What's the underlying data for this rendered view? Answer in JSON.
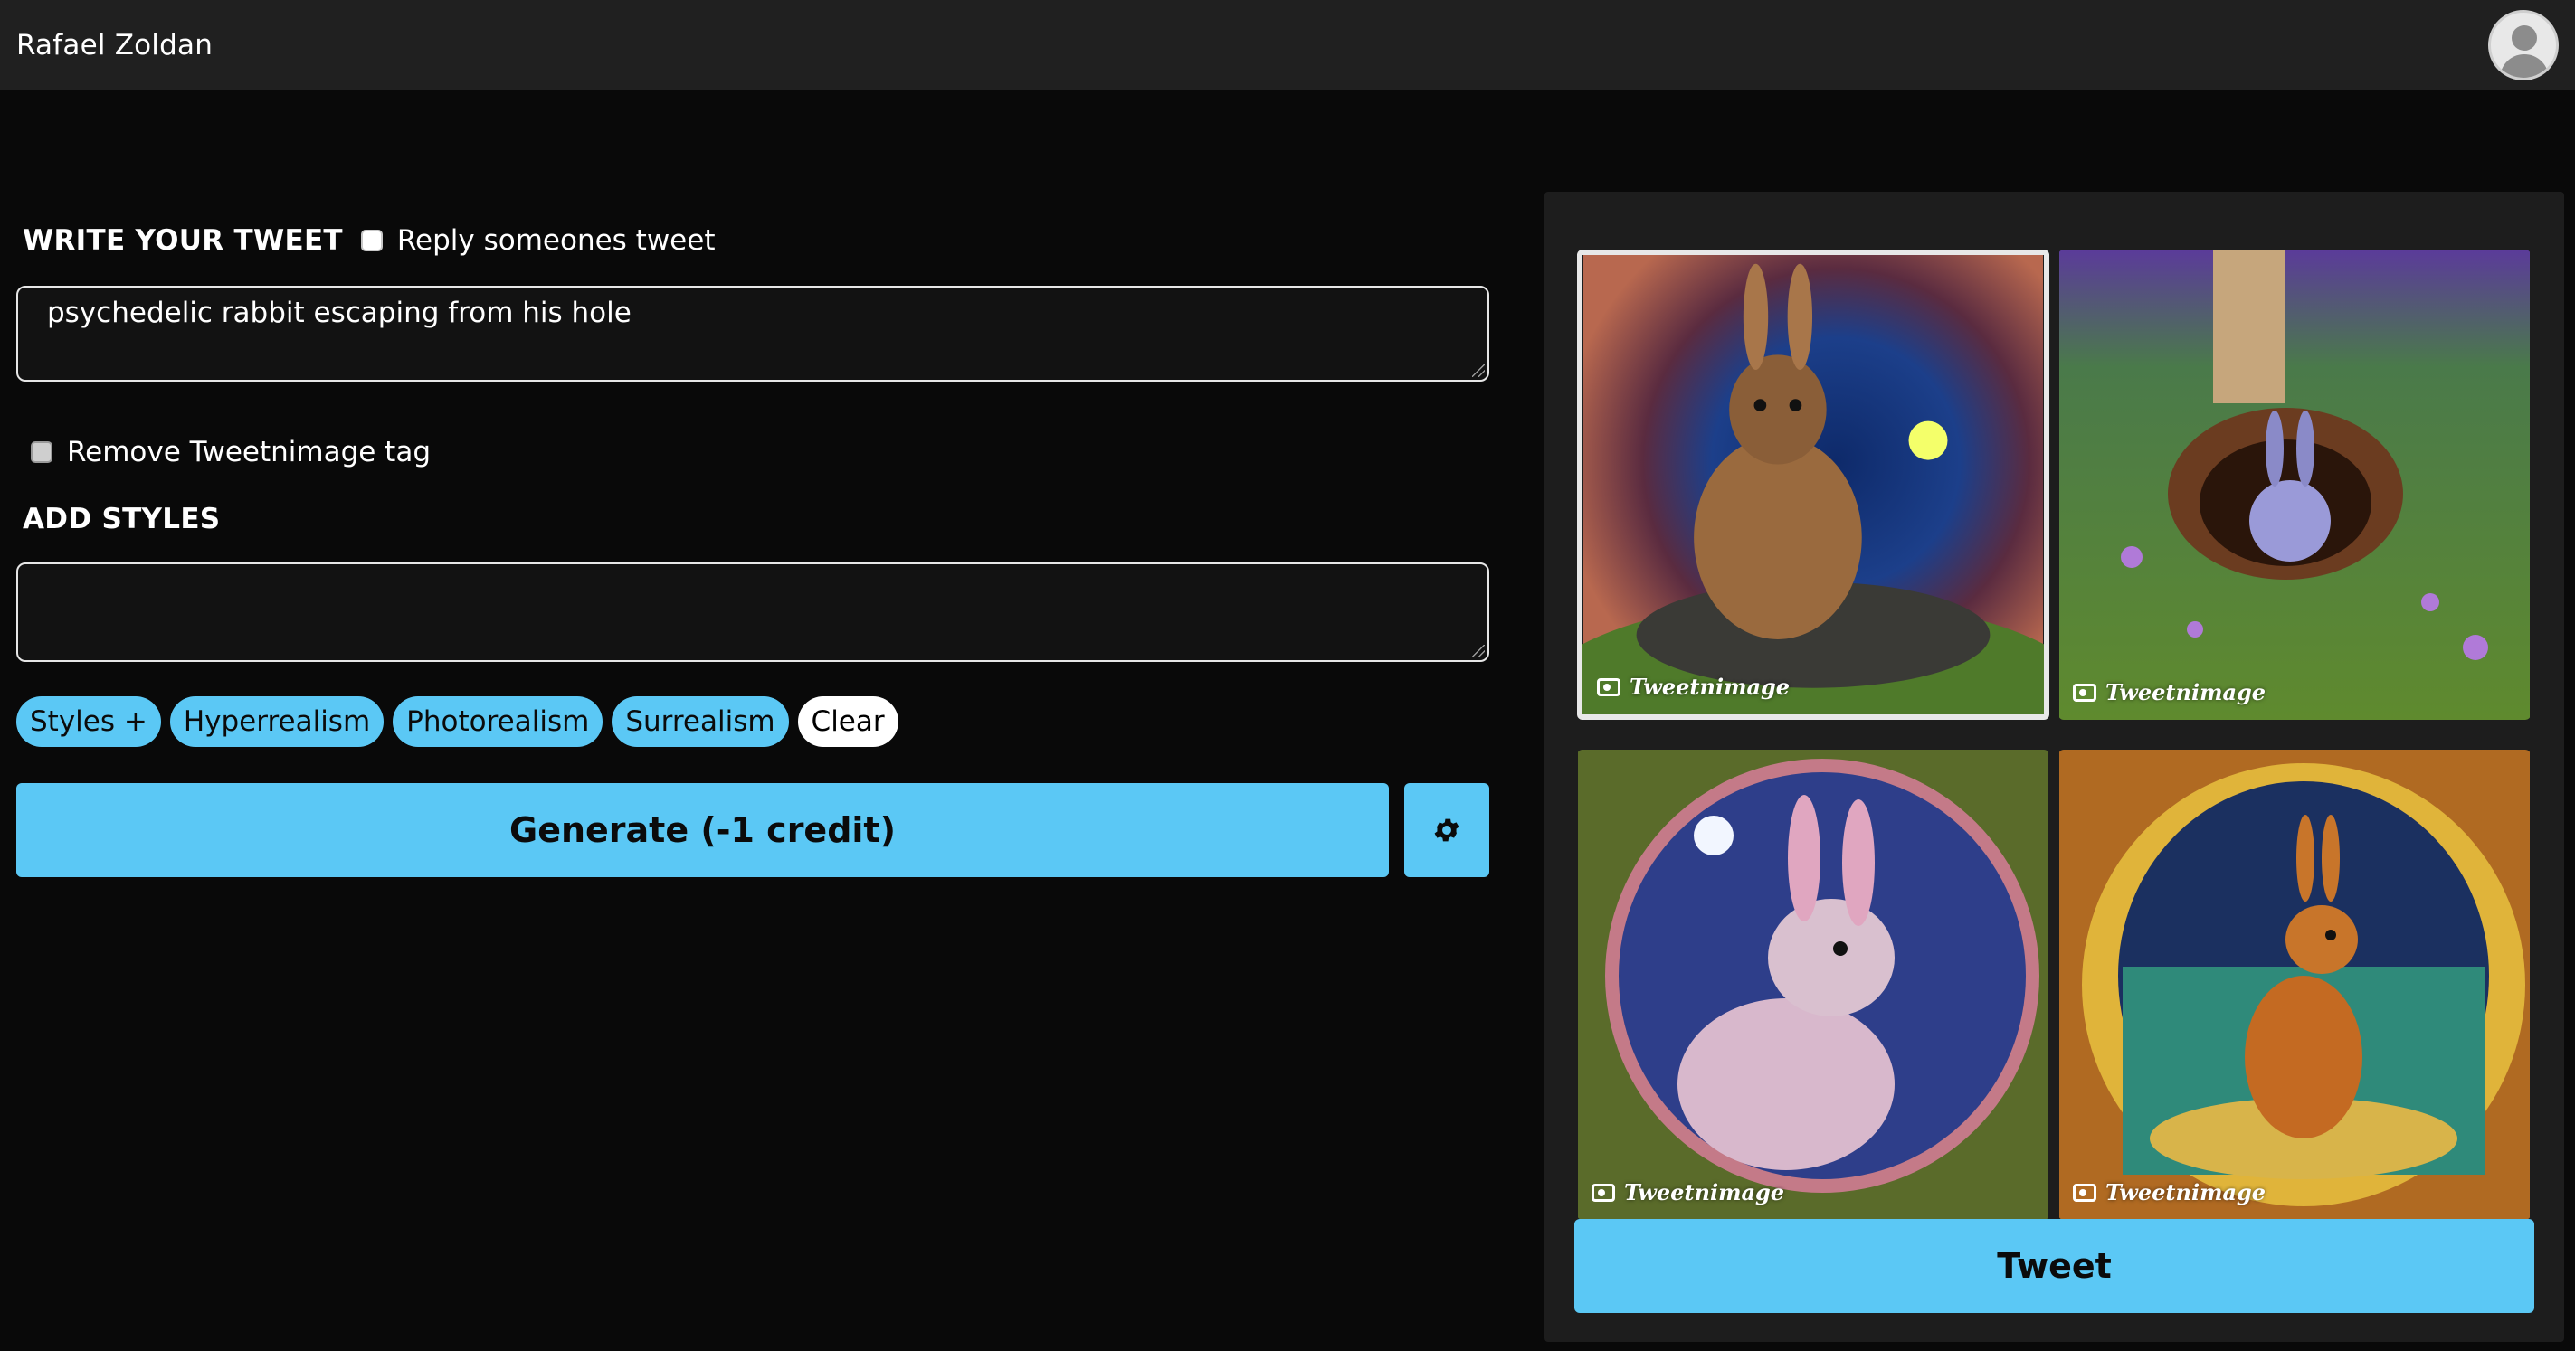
{
  "header": {
    "username": "Rafael Zoldan"
  },
  "form": {
    "tweet_section_title": "WRITE YOUR TWEET",
    "reply_checkbox_label": "Reply someones tweet",
    "reply_checked": false,
    "tweet_text": "psychedelic rabbit escaping from his hole",
    "remove_tag_label": "Remove Tweetnimage tag",
    "remove_tag_checked": false,
    "styles_section_title": "ADD STYLES",
    "styles_text": "",
    "style_chips": [
      "Styles +",
      "Hyperrealism",
      "Photorealism",
      "Surrealism"
    ],
    "clear_label": "Clear",
    "generate_label": "Generate (-1 credit)",
    "settings_icon": "gear-icon"
  },
  "results": {
    "images": [
      {
        "watermark": "Tweetnimage",
        "selected": true
      },
      {
        "watermark": "Tweetnimage",
        "selected": false
      },
      {
        "watermark": "Tweetnimage",
        "selected": false
      },
      {
        "watermark": "Tweetnimage",
        "selected": false
      }
    ],
    "tweet_label": "Tweet"
  },
  "colors": {
    "accent": "#5bc8f5",
    "background": "#090909",
    "header": "#202020",
    "panel": "#1d1d1d"
  }
}
